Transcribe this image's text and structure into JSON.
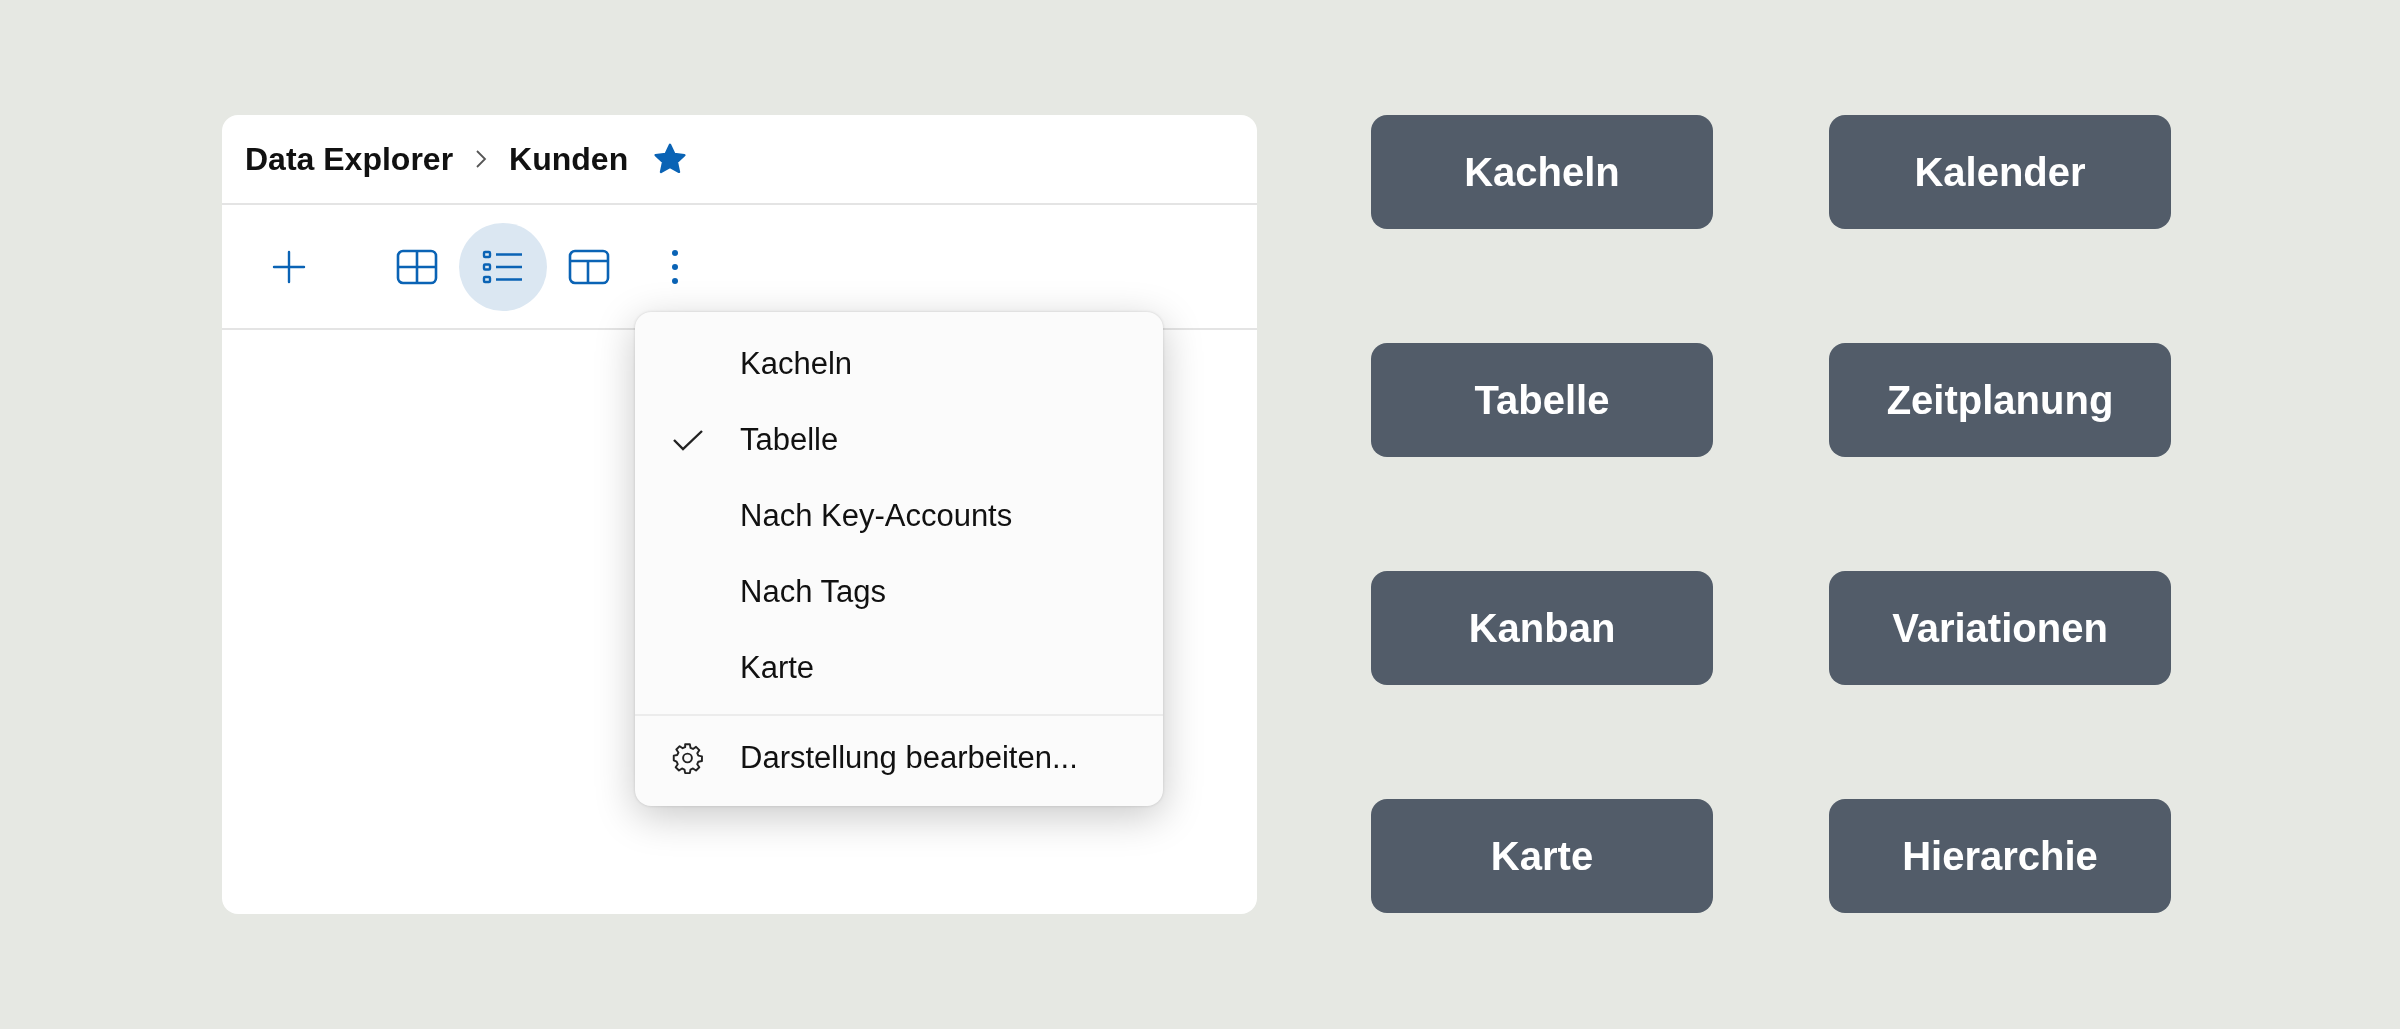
{
  "breadcrumb": {
    "parent": "Data Explorer",
    "current": "Kunden",
    "favorite": true
  },
  "toolbar": [
    {
      "kind": "add",
      "selected": false
    },
    {
      "kind": "tiles",
      "selected": false
    },
    {
      "kind": "list",
      "selected": true
    },
    {
      "kind": "table",
      "selected": false
    },
    {
      "kind": "more",
      "selected": false
    }
  ],
  "menu": {
    "items": [
      {
        "label": "Kacheln",
        "checked": false
      },
      {
        "label": "Tabelle",
        "checked": true
      },
      {
        "label": "Nach Key-Accounts",
        "checked": false
      },
      {
        "label": "Nach Tags",
        "checked": false
      },
      {
        "label": "Karte",
        "checked": false
      }
    ],
    "footer": "Darstellung bearbeiten..."
  },
  "view_buttons": [
    "Kacheln",
    "Kalender",
    "Tabelle",
    "Zeitplanung",
    "Kanban",
    "Variationen",
    "Karte",
    "Hierarchie"
  ]
}
